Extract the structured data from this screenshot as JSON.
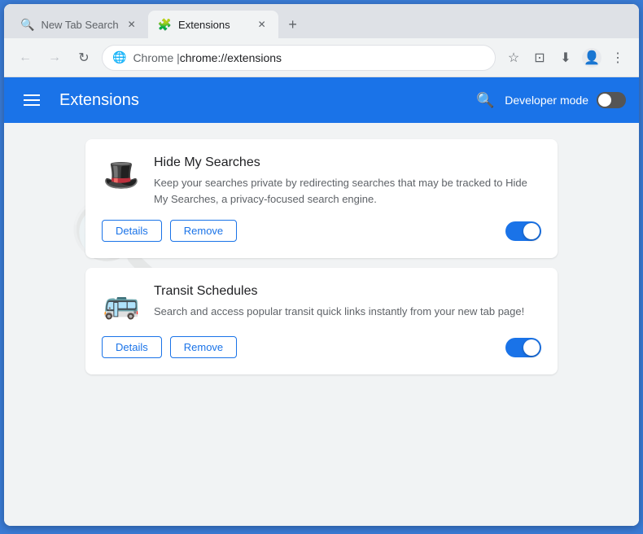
{
  "browser": {
    "tabs": [
      {
        "id": "tab-1",
        "title": "New Tab Search",
        "icon": "🔍",
        "active": false
      },
      {
        "id": "tab-2",
        "title": "Extensions",
        "icon": "🧩",
        "active": true
      }
    ],
    "new_tab_label": "+",
    "address": {
      "domain": "Chrome  |  ",
      "url": "chrome://extensions",
      "back_title": "Back",
      "forward_title": "Forward",
      "refresh_title": "Refresh"
    }
  },
  "extensions_page": {
    "header": {
      "title": "Extensions",
      "hamburger_label": "Menu",
      "search_label": "Search extensions",
      "dev_mode_label": "Developer mode",
      "dev_mode_on": false
    },
    "extensions": [
      {
        "id": "ext-1",
        "name": "Hide My Searches",
        "description": "Keep your searches private by redirecting searches that may be tracked to Hide My Searches, a privacy-focused search engine.",
        "icon": "🎩",
        "enabled": true,
        "details_label": "Details",
        "remove_label": "Remove"
      },
      {
        "id": "ext-2",
        "name": "Transit Schedules",
        "description": "Search and access popular transit quick links instantly from your new tab page!",
        "icon": "🚌",
        "enabled": true,
        "details_label": "Details",
        "remove_label": "Remove"
      }
    ]
  }
}
